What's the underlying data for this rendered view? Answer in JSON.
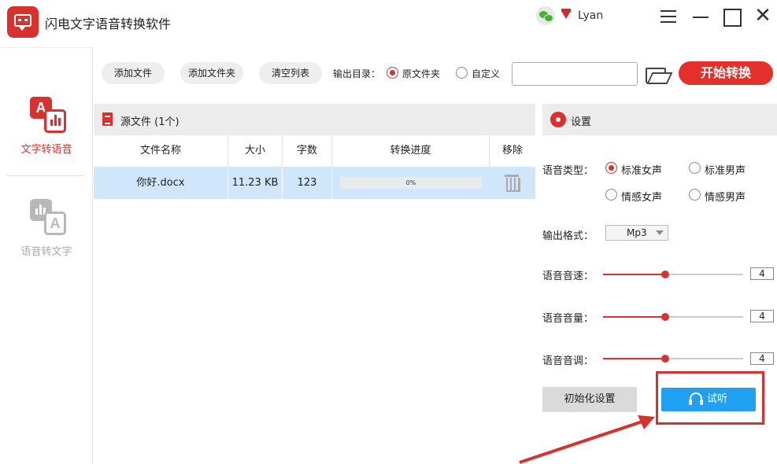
{
  "app": {
    "title": "闪电文字语音转换软件",
    "username": "Lyan"
  },
  "sidebar": {
    "items": [
      {
        "label": "文字转语音",
        "icon": "text-to-speech-icon",
        "active": true,
        "color": "#d8322e"
      },
      {
        "label": "语音转文字",
        "icon": "speech-to-text-icon",
        "active": false,
        "color": "#b8b8b8"
      }
    ]
  },
  "toolbar": {
    "add_file": "添加文件",
    "add_folder": "添加文件夹",
    "clear_list": "清空列表",
    "output_dir_label": "输出目录：",
    "option_source_folder": "原文件夹",
    "option_custom": "自定义",
    "selected_output": "原文件夹",
    "path_value": "",
    "start": "开始转换"
  },
  "files": {
    "title": "源文件 (1个)",
    "columns": [
      "文件名称",
      "大小",
      "字数",
      "转换进度",
      "移除"
    ],
    "rows": [
      {
        "name": "你好.docx",
        "size": "11.23 KB",
        "chars": "123",
        "progress": "0%",
        "progress_value": 0
      }
    ]
  },
  "settings": {
    "title": "设置",
    "voice_type_label": "语音类型：",
    "voice_options": [
      "标准女声",
      "标准男声",
      "情感女声",
      "情感男声"
    ],
    "selected_voice": "标准女声",
    "format_label": "输出格式：",
    "format_value": "Mp3",
    "speed_label": "语音音速：",
    "speed_value": "4",
    "volume_label": "语音音量：",
    "volume_value": "4",
    "pitch_label": "语音音调：",
    "pitch_value": "4",
    "reset": "初始化设置",
    "listen": "试听"
  },
  "colors": {
    "accent": "#d8322e",
    "listen_button": "#1fa0f0",
    "selected_row": "#cfe6fb"
  }
}
